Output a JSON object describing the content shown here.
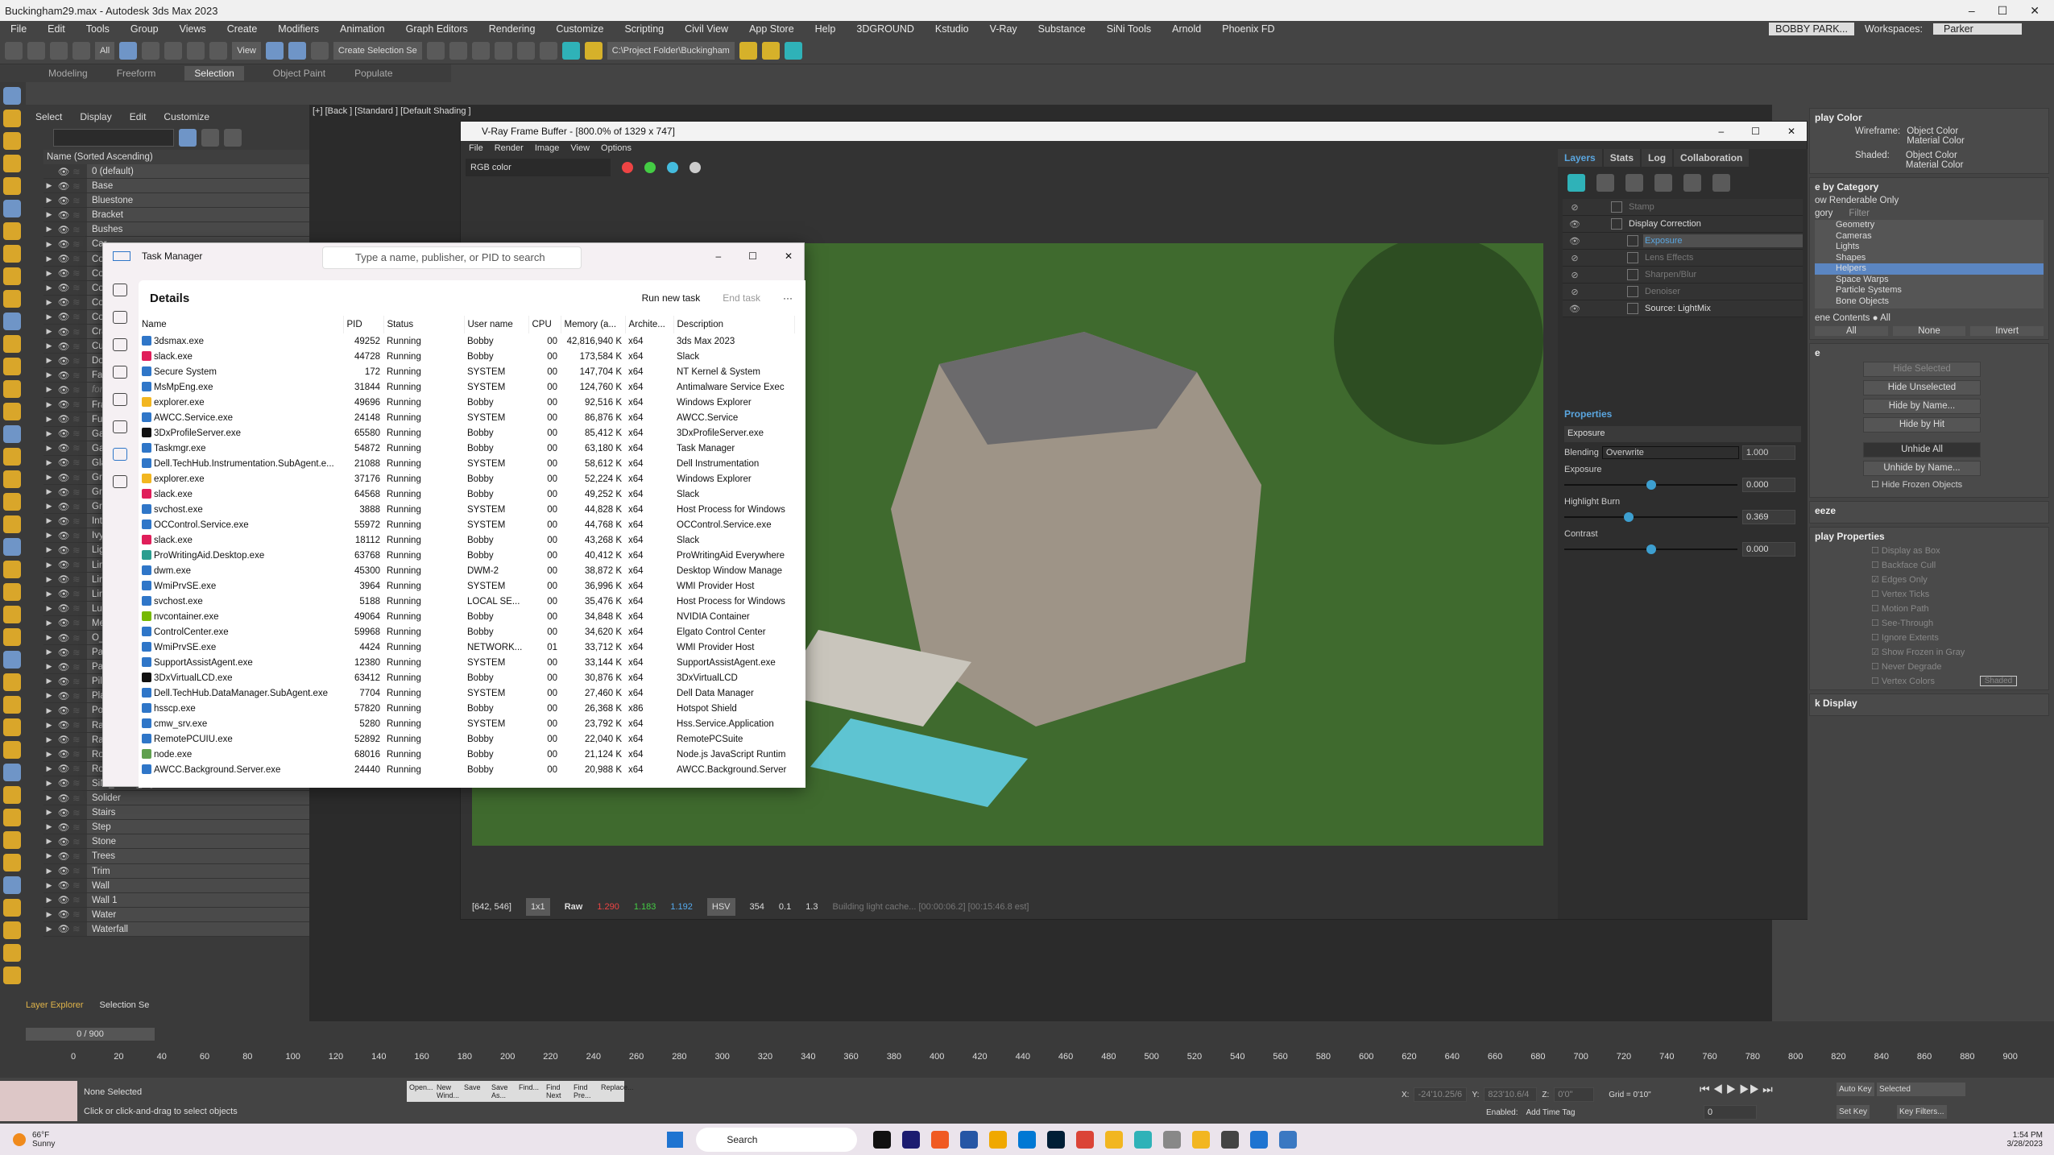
{
  "app": {
    "title": "Buckingham29.max - Autodesk 3ds Max 2023",
    "window_controls": [
      "–",
      "☐",
      "✕"
    ],
    "menu": [
      "File",
      "Edit",
      "Tools",
      "Group",
      "Views",
      "Create",
      "Modifiers",
      "Animation",
      "Graph Editors",
      "Rendering",
      "Customize",
      "Scripting",
      "Civil View",
      "App Store",
      "Help",
      "3DGROUND",
      "Kstudio",
      "V-Ray",
      "Substance",
      "SiNi Tools",
      "Arnold",
      "Phoenix FD"
    ],
    "user": "BOBBY PARK...",
    "workspaces_label": "Workspaces:",
    "workspace": "Parker"
  },
  "toolbar": {
    "selection_filter": "All",
    "reference_coord": "View",
    "selection_set": "Create Selection Se",
    "project_folder": "C:\\Project Folder\\Buckingham"
  },
  "ribbon": {
    "tabs": [
      "Modeling",
      "Freeform",
      "Selection",
      "Object Paint",
      "Populate"
    ],
    "active": "Selection"
  },
  "explorer": {
    "menu": [
      "Select",
      "Display",
      "Edit",
      "Customize"
    ],
    "column_header": "Name (Sorted Ascending)",
    "layers": [
      "0 (default)",
      "Base",
      "Bluestone",
      "Bracket",
      "Bushes",
      "Car",
      "Cob",
      "Cor",
      "Cop",
      "Cou",
      "Cou",
      "Cra",
      "Cur",
      "Doc",
      "Fas",
      "fore",
      "Fra",
      "Fur",
      "Gar",
      "Gat",
      "Glas",
      "Gra",
      "Gra",
      "Gra",
      "Inte",
      "Ivy",
      "Ligh",
      "Lime",
      "Line",
      "Line",
      "Luv",
      "Met",
      "O_",
      "Pati",
      "Pav",
      "Pille",
      "Plan",
      "Pool",
      "Rail",
      "Rail",
      "Rock",
      "Roo",
      "SiNi_HDRI_Lights",
      "Solider",
      "Stairs",
      "Step",
      "Stone",
      "Trees",
      "Trim",
      "Wall",
      "Wall 1",
      "Water",
      "Waterfall"
    ],
    "bottom_label": "Layer Explorer",
    "selection_label": "Selection Se"
  },
  "viewport": {
    "label": "[+] [Back ] [Standard ] [Default Shading ]"
  },
  "vfb": {
    "title": "V-Ray Frame Buffer - [800.0% of 1329 x 747]",
    "menu": [
      "File",
      "Render",
      "Image",
      "View",
      "Options"
    ],
    "channel": "RGB color",
    "status": {
      "coords": "[642, 546]",
      "zoom": "1x1",
      "raw_label": "Raw",
      "r": "1.290",
      "g": "1.183",
      "b": "1.192",
      "color_mode": "HSV",
      "h": "354",
      "s": "0.1",
      "v": "1.3",
      "message": "Building light cache... [00:00:06.2] [00:15:46.8 est]"
    },
    "tabs": [
      "Layers",
      "Stats",
      "Log",
      "Collaboration"
    ],
    "layers": [
      {
        "name": "Stamp",
        "visible": false
      },
      {
        "name": "Display Correction",
        "visible": true
      },
      {
        "name": "Exposure",
        "visible": true,
        "selected": true
      },
      {
        "name": "Lens Effects",
        "visible": false
      },
      {
        "name": "Sharpen/Blur",
        "visible": false
      },
      {
        "name": "Denoiser",
        "visible": false
      },
      {
        "name": "Source: LightMix",
        "visible": true
      }
    ],
    "properties": {
      "heading": "Properties",
      "layer_name": "Exposure",
      "blending_label": "Blending",
      "blending": "Overwrite",
      "blending_amount": "1.000",
      "sliders": [
        {
          "label": "Exposure",
          "value": "0.000",
          "fraction": 0.5
        },
        {
          "label": "Highlight Burn",
          "value": "0.369",
          "fraction": 0.37
        },
        {
          "label": "Contrast",
          "value": "0.000",
          "fraction": 0.5
        }
      ]
    }
  },
  "taskmgr": {
    "title": "Task Manager",
    "search_placeholder": "Type a name, publisher, or PID to search",
    "page": "Details",
    "run_new_task": "Run new task",
    "end_task": "End task",
    "more": "···",
    "columns": [
      "Name",
      "PID",
      "Status",
      "User name",
      "CPU",
      "Memory (a...",
      "Archite...",
      "Description"
    ],
    "rows": [
      [
        "3dsmax.exe",
        "49252",
        "Running",
        "Bobby",
        "00",
        "42,816,940 K",
        "x64",
        "3ds Max 2023"
      ],
      [
        "slack.exe",
        "44728",
        "Running",
        "Bobby",
        "00",
        "173,584 K",
        "x64",
        "Slack"
      ],
      [
        "Secure System",
        "172",
        "Running",
        "SYSTEM",
        "00",
        "147,704 K",
        "x64",
        "NT Kernel & System"
      ],
      [
        "MsMpEng.exe",
        "31844",
        "Running",
        "SYSTEM",
        "00",
        "124,760 K",
        "x64",
        "Antimalware Service Exec"
      ],
      [
        "explorer.exe",
        "49696",
        "Running",
        "Bobby",
        "00",
        "92,516 K",
        "x64",
        "Windows Explorer"
      ],
      [
        "AWCC.Service.exe",
        "24148",
        "Running",
        "SYSTEM",
        "00",
        "86,876 K",
        "x64",
        "AWCC.Service"
      ],
      [
        "3DxProfileServer.exe",
        "65580",
        "Running",
        "Bobby",
        "00",
        "85,412 K",
        "x64",
        "3DxProfileServer.exe"
      ],
      [
        "Taskmgr.exe",
        "54872",
        "Running",
        "Bobby",
        "00",
        "63,180 K",
        "x64",
        "Task Manager"
      ],
      [
        "Dell.TechHub.Instrumentation.SubAgent.e...",
        "21088",
        "Running",
        "SYSTEM",
        "00",
        "58,612 K",
        "x64",
        "Dell Instrumentation"
      ],
      [
        "explorer.exe",
        "37176",
        "Running",
        "Bobby",
        "00",
        "52,224 K",
        "x64",
        "Windows Explorer"
      ],
      [
        "slack.exe",
        "64568",
        "Running",
        "Bobby",
        "00",
        "49,252 K",
        "x64",
        "Slack"
      ],
      [
        "svchost.exe",
        "3888",
        "Running",
        "SYSTEM",
        "00",
        "44,828 K",
        "x64",
        "Host Process for Windows"
      ],
      [
        "OCControl.Service.exe",
        "55972",
        "Running",
        "SYSTEM",
        "00",
        "44,768 K",
        "x64",
        "OCControl.Service.exe"
      ],
      [
        "slack.exe",
        "18112",
        "Running",
        "Bobby",
        "00",
        "43,268 K",
        "x64",
        "Slack"
      ],
      [
        "ProWritingAid.Desktop.exe",
        "63768",
        "Running",
        "Bobby",
        "00",
        "40,412 K",
        "x64",
        "ProWritingAid Everywhere"
      ],
      [
        "dwm.exe",
        "45300",
        "Running",
        "DWM-2",
        "00",
        "38,872 K",
        "x64",
        "Desktop Window Manage"
      ],
      [
        "WmiPrvSE.exe",
        "3964",
        "Running",
        "SYSTEM",
        "00",
        "36,996 K",
        "x64",
        "WMI Provider Host"
      ],
      [
        "svchost.exe",
        "5188",
        "Running",
        "LOCAL SE...",
        "00",
        "35,476 K",
        "x64",
        "Host Process for Windows"
      ],
      [
        "nvcontainer.exe",
        "49064",
        "Running",
        "Bobby",
        "00",
        "34,848 K",
        "x64",
        "NVIDIA Container"
      ],
      [
        "ControlCenter.exe",
        "59968",
        "Running",
        "Bobby",
        "00",
        "34,620 K",
        "x64",
        "Elgato Control Center"
      ],
      [
        "WmiPrvSE.exe",
        "4424",
        "Running",
        "NETWORK...",
        "01",
        "33,712 K",
        "x64",
        "WMI Provider Host"
      ],
      [
        "SupportAssistAgent.exe",
        "12380",
        "Running",
        "SYSTEM",
        "00",
        "33,144 K",
        "x64",
        "SupportAssistAgent.exe"
      ],
      [
        "3DxVirtualLCD.exe",
        "63412",
        "Running",
        "Bobby",
        "00",
        "30,876 K",
        "x64",
        "3DxVirtualLCD"
      ],
      [
        "Dell.TechHub.DataManager.SubAgent.exe",
        "7704",
        "Running",
        "SYSTEM",
        "00",
        "27,460 K",
        "x64",
        "Dell Data Manager"
      ],
      [
        "hsscp.exe",
        "57820",
        "Running",
        "Bobby",
        "00",
        "26,368 K",
        "x86",
        "Hotspot Shield"
      ],
      [
        "cmw_srv.exe",
        "5280",
        "Running",
        "SYSTEM",
        "00",
        "23,792 K",
        "x64",
        "Hss.Service.Application"
      ],
      [
        "RemotePCUIU.exe",
        "52892",
        "Running",
        "Bobby",
        "00",
        "22,040 K",
        "x64",
        "RemotePCSuite"
      ],
      [
        "node.exe",
        "68016",
        "Running",
        "Bobby",
        "00",
        "21,124 K",
        "x64",
        "Node.js JavaScript Runtim"
      ],
      [
        "AWCC.Background.Server.exe",
        "24440",
        "Running",
        "Bobby",
        "00",
        "20,988 K",
        "x64",
        "AWCC.Background.Server"
      ]
    ]
  },
  "cmdpanel": {
    "display_color": "play Color",
    "wireframe_label": "Wireframe:",
    "shaded_label": "Shaded:",
    "object_color": "Object Color",
    "material_color": "Material Color",
    "hide_by_category": "e by Category",
    "show_renderable": "ow Renderable Only",
    "cat_tabs": [
      "gory",
      "Filter"
    ],
    "categories": [
      "Geometry",
      "Cameras",
      "Lights",
      "Shapes",
      "Helpers",
      "Space Warps",
      "Particle Systems",
      "Bone Objects"
    ],
    "selected_category": "Helpers",
    "scene_contents": "ene Contents",
    "all_radio": "All",
    "cat_buttons": [
      "All",
      "None",
      "Invert"
    ],
    "hide_title": "e",
    "hide_buttons": [
      "Hide Selected",
      "Hide Unselected",
      "Hide by Name...",
      "Hide by Hit",
      "Unhide All",
      "Unhide by Name..."
    ],
    "hide_frozen": "Hide Frozen Objects",
    "freeze_title": "eeze",
    "display_props_title": "play Properties",
    "display_props": [
      "Display as Box",
      "Backface Cull",
      "Edges Only",
      "Vertex Ticks",
      "Motion Path",
      "See-Through",
      "Ignore Extents",
      "Show Frozen in Gray",
      "Never Degrade",
      "Vertex Colors"
    ],
    "checked": [
      "Edges Only",
      "Show Frozen in Gray"
    ],
    "shaded_btn": "Shaded",
    "link_display": "k Display"
  },
  "timeline": {
    "frame": "0 / 900",
    "ticks": [
      "0",
      "20",
      "40",
      "60",
      "80",
      "100",
      "120",
      "140",
      "160",
      "180",
      "200",
      "220",
      "240",
      "260",
      "280",
      "300",
      "320",
      "340",
      "360",
      "380",
      "400",
      "420",
      "440",
      "460",
      "480",
      "500",
      "520",
      "540",
      "560",
      "580",
      "600",
      "620",
      "640",
      "660",
      "680",
      "700",
      "720",
      "740",
      "760",
      "780",
      "800",
      "820",
      "840",
      "860",
      "880",
      "900"
    ]
  },
  "status": {
    "selection": "None Selected",
    "prompt": "Click or click-and-drag to select objects",
    "x_label": "X:",
    "x": "-24'10.25/6",
    "y_label": "Y:",
    "y": "823'10.6/4",
    "z_label": "Z:",
    "z": "0'0\"",
    "grid": "Grid = 0'10\"",
    "enabled": "Enabled:",
    "add_time_tag": "Add Time Tag",
    "auto_key": "Auto Key",
    "set_key": "Set Key",
    "key_mode": "Selected",
    "key_filters": "Key Filters...",
    "frame_value": "0",
    "script_buttons": [
      "Open...",
      "New Wind...",
      "Save",
      "Save As...",
      "Find...",
      "Find Next",
      "Find Pre...",
      "Replace..."
    ]
  },
  "taskbar": {
    "weather_temp": "66°F",
    "weather_text": "Sunny",
    "search": "Search",
    "time": "1:54 PM",
    "date": "3/28/2023"
  },
  "colors": {
    "accent": "#5aa6e0",
    "highlight": "#5b86c2",
    "vfb_slider": "#3d9fd0"
  }
}
